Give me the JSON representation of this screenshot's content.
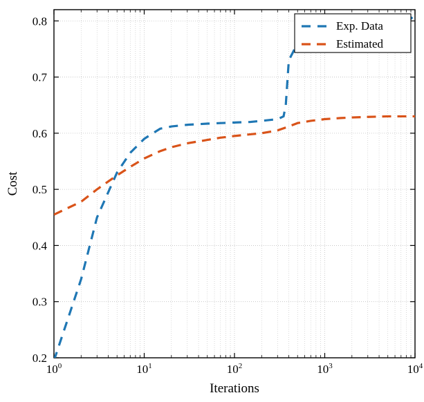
{
  "chart_data": {
    "type": "line",
    "title": "",
    "xlabel": "Iterations",
    "ylabel": "Cost",
    "xscale": "log",
    "xlim": [
      1,
      10000
    ],
    "ylim": [
      0.2,
      0.82
    ],
    "xticks": [
      1,
      10,
      100,
      1000,
      10000
    ],
    "xtick_labels": [
      "10^0",
      "10^1",
      "10^2",
      "10^3",
      "10^4"
    ],
    "yticks": [
      0.2,
      0.3,
      0.4,
      0.5,
      0.6,
      0.7,
      0.8
    ],
    "ytick_labels": [
      "0.2",
      "0.3",
      "0.4",
      "0.5",
      "0.6",
      "0.7",
      "0.8"
    ],
    "grid": true,
    "legend_position": "top-right",
    "series": [
      {
        "name": "Exp. Data",
        "color": "#1f77b4",
        "style": "dashed",
        "x": [
          1,
          2,
          3,
          5,
          7,
          10,
          15,
          20,
          30,
          50,
          70,
          100,
          150,
          200,
          300,
          350,
          370,
          400,
          500,
          700,
          1000,
          1500,
          2000,
          3000,
          5000,
          7000,
          10000
        ],
        "y": [
          0.195,
          0.34,
          0.45,
          0.53,
          0.565,
          0.59,
          0.608,
          0.612,
          0.615,
          0.617,
          0.618,
          0.619,
          0.62,
          0.622,
          0.625,
          0.63,
          0.65,
          0.73,
          0.76,
          0.765,
          0.768,
          0.77,
          0.772,
          0.775,
          0.78,
          0.79,
          0.81
        ],
        "dash_pattern": "13 10"
      },
      {
        "name": "Estimated",
        "color": "#d95319",
        "style": "dashed",
        "x": [
          1,
          2,
          3,
          5,
          7,
          10,
          15,
          20,
          30,
          50,
          70,
          100,
          150,
          200,
          300,
          400,
          500,
          700,
          1000,
          1500,
          2000,
          3000,
          5000,
          7000,
          10000
        ],
        "y": [
          0.455,
          0.478,
          0.5,
          0.525,
          0.54,
          0.555,
          0.568,
          0.575,
          0.582,
          0.588,
          0.592,
          0.595,
          0.598,
          0.6,
          0.605,
          0.612,
          0.618,
          0.622,
          0.625,
          0.627,
          0.628,
          0.629,
          0.63,
          0.63,
          0.63
        ],
        "dash_pattern": "13 9"
      }
    ]
  }
}
